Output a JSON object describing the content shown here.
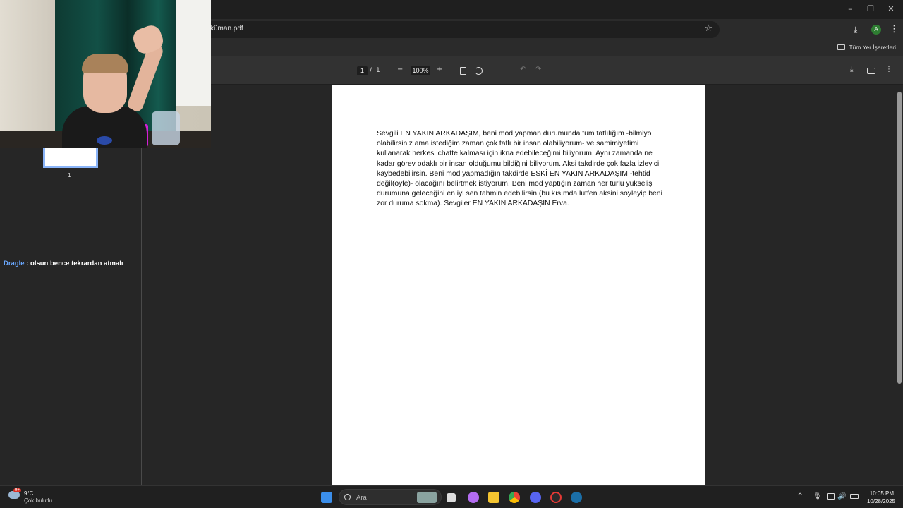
{
  "browser": {
    "url_text": "küman.pdf",
    "bookmarks_all_label": "Tüm Yer İşaretleri",
    "window_controls": {
      "minimize": "–",
      "restore": "❐",
      "close": "✕"
    },
    "star_icon": "☆",
    "extensions": [
      {
        "name": "ext-red-icon",
        "color": "#e53935"
      },
      {
        "name": "ext-blue-icon",
        "color": "#1e88e5"
      },
      {
        "name": "ext-grammarly-icon",
        "color": "#15c39a"
      },
      {
        "name": "ext-purple-icon",
        "color": "#9c27b0"
      },
      {
        "name": "ext-white-icon",
        "color": "#eeeeee"
      },
      {
        "name": "ext-dark-icon",
        "color": "#3949ab"
      },
      {
        "name": "extensions-puzzle-icon",
        "color": "#bdbdbd"
      }
    ],
    "profile_initial": "A",
    "menu_icon": "⋮",
    "download_icon": "⤓"
  },
  "pdf": {
    "page_current": "1",
    "page_separator": "/",
    "page_total": "1",
    "zoom_minus": "−",
    "zoom_level": "100%",
    "zoom_plus": "+",
    "thumbnail_label": "1",
    "document_text": "Sevgili EN YAKIN ARKADAŞIM, beni mod yapman durumunda tüm tatlılığım -bilmiyo olabilirsiniz ama istediğim zaman çok tatlı bir insan olabiliyorum- ve samimiyetimi kullanarak herkesi chatte kalması için ikna edebileceğimi biliyorum. Aynı zamanda ne kadar görev odaklı bir insan olduğumu bildiğini biliyorum. Aksi takdirde çok fazla izleyici kaybedebilirsin. Beni mod yapmadığın takdirde ESKİ EN YAKIN ARKADAŞIM -tehtid değil(öyle)- olacağını belirtmek istiyorum. Beni mod yaptığın zaman her türlü yükseliş durumuna geleceğini en iyi sen tahmin edebilirsin (bu kısımda lütfen aksini söyleyip beni zor duruma sokma). Sevgiler EN YAKIN ARKADAŞIN Erva."
  },
  "chat": {
    "user": "Dragle",
    "separator": " : ",
    "message": "olsun bence tekrardan atmalı"
  },
  "taskbar": {
    "weather_temp": "9°C",
    "weather_desc": "Çok bulutlu",
    "weather_badge": "9+",
    "search_placeholder": "Ara",
    "time": "10:05 PM",
    "date": "10/28/2025",
    "tray_chevron": "^",
    "apps": [
      {
        "name": "start-icon",
        "color": "#3b8eea"
      },
      {
        "name": "widgets-icon",
        "color": "#8aa3a0"
      },
      {
        "name": "terminal-icon",
        "color": "#dddddd"
      },
      {
        "name": "copilot-icon",
        "color": "#b36cf0"
      },
      {
        "name": "file-explorer-icon",
        "color": "#f4c430"
      },
      {
        "name": "chrome-icon",
        "color": "#34a853"
      },
      {
        "name": "discord-icon",
        "color": "#5865f2"
      },
      {
        "name": "app-red-icon",
        "color": "#e53935"
      },
      {
        "name": "steam-icon",
        "color": "#1b6fa8"
      }
    ]
  }
}
